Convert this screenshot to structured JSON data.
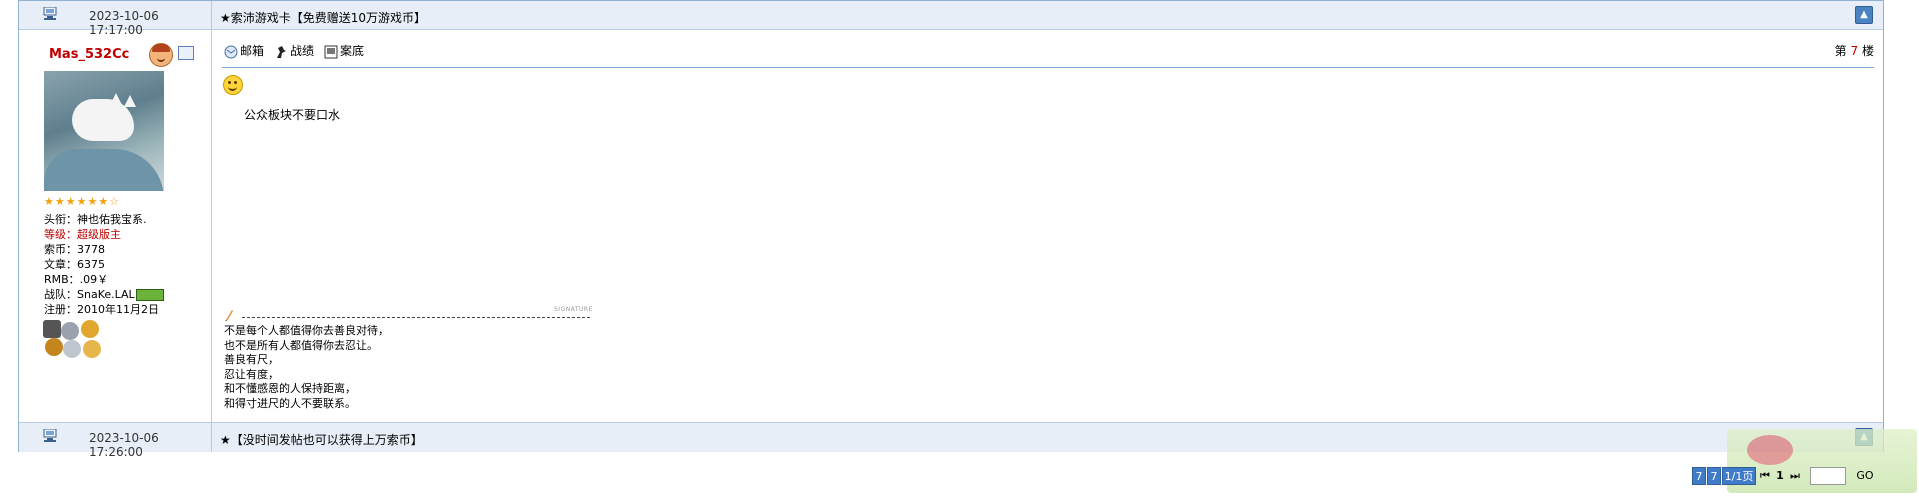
{
  "post1": {
    "header": {
      "date": "2023-10-06 17:17:00",
      "title": "★索沛游戏卡【免费赠送10万游戏币】"
    },
    "user": {
      "name": "Mas_532Cc",
      "stars": "★★★★★★☆",
      "info": [
        {
          "key": "title",
          "text": "头衔：神也佑我宝系."
        },
        {
          "key": "level",
          "text": "等级：超级版主"
        },
        {
          "key": "coins",
          "text": "索币：3778"
        },
        {
          "key": "posts",
          "text": "文章：6375"
        },
        {
          "key": "rmb",
          "text": "RMB：.09￥"
        },
        {
          "key": "team",
          "text": "战队：SnaKe.LAL"
        },
        {
          "key": "reg",
          "text": "注册：2010年11月2日"
        }
      ]
    },
    "toolbar": {
      "mail": "邮箱",
      "record": "战绩",
      "case": "案底"
    },
    "floor": {
      "prefix": "第",
      "num": "7",
      "suffix": "楼"
    },
    "content": "公众板块不要口水",
    "signature_label": "SIGNATURE",
    "signature": [
      "不是每个人都值得你去善良对待，",
      "也不是所有人都值得你去忍让。",
      "善良有尺，",
      "忍让有度，",
      "和不懂感恩的人保持距离，",
      "和得寸进尺的人不要联系。"
    ]
  },
  "post2": {
    "header": {
      "date": "2023-10-06 17:26:00",
      "title": "★【没时间发帖也可以获得上万索币】"
    }
  },
  "pager": {
    "total": "7",
    "per": "7",
    "pages": "1/1页",
    "current": "1",
    "goto": "GO"
  },
  "icons": [
    "computer-icon",
    "face-icon",
    "message-icon",
    "mail-icon",
    "record-icon",
    "case-icon",
    "smiley-icon",
    "pen-icon",
    "up-arrow-icon"
  ],
  "colors": {
    "username": "#c00000",
    "border": "#8fb1d3",
    "header_bg": "#e8eef7",
    "pager_blue": "#3f7bc8"
  }
}
